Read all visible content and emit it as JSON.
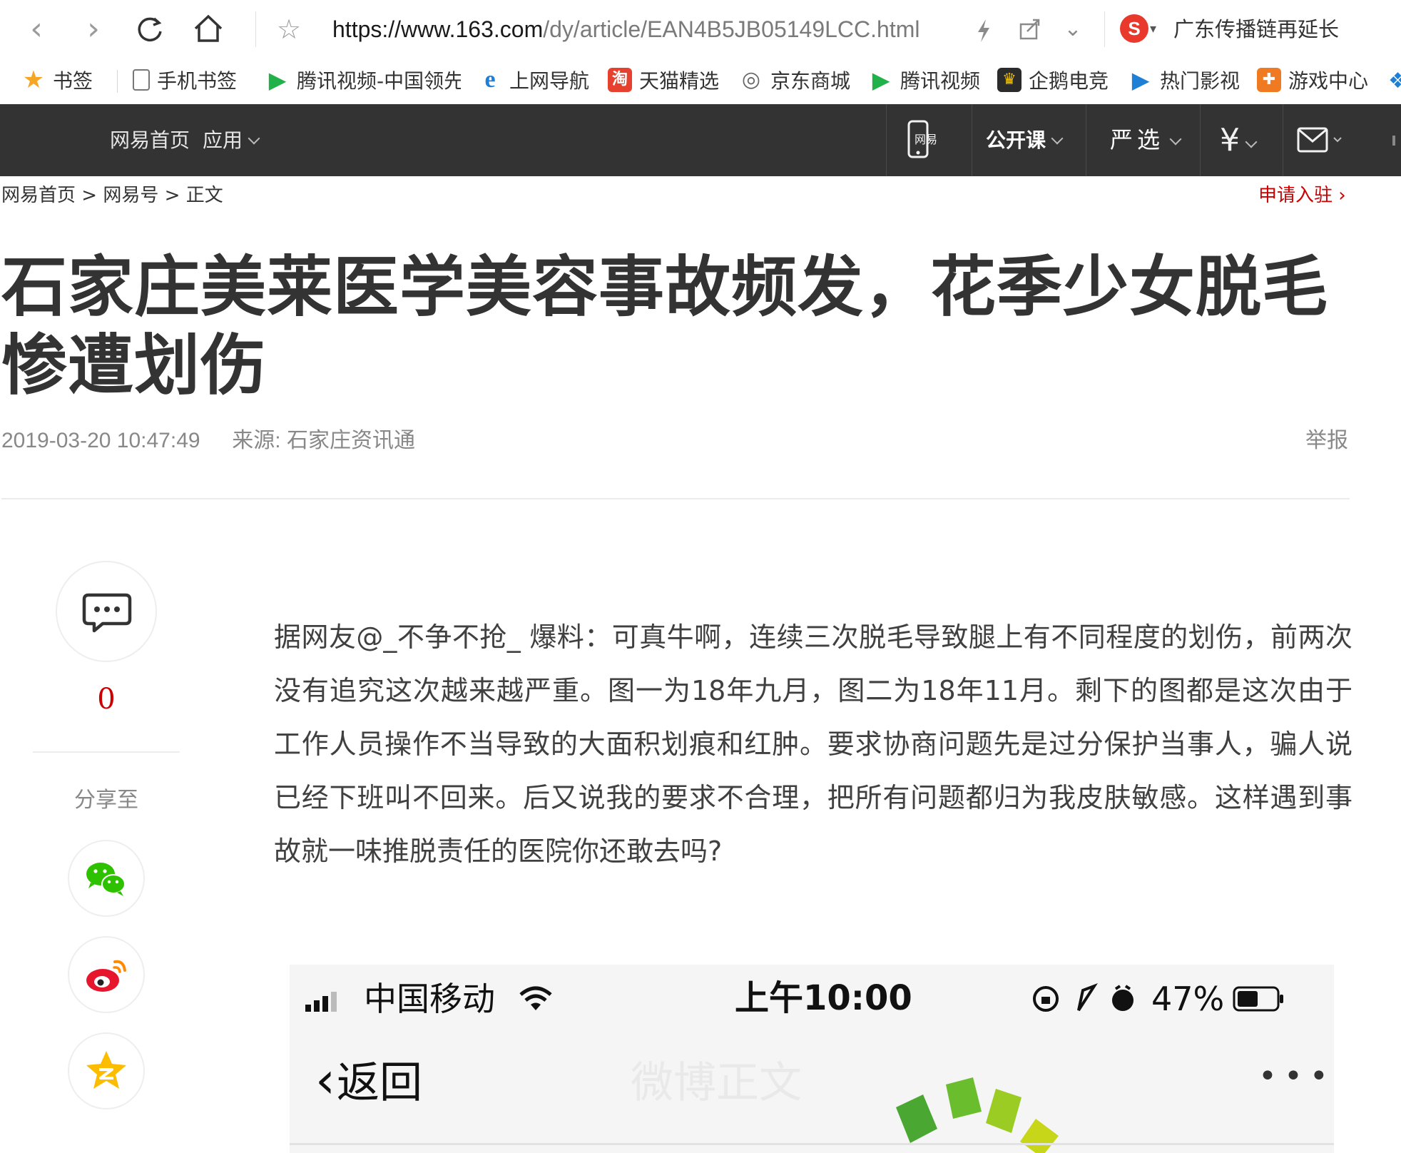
{
  "browser": {
    "url_host": "https://www.163.com",
    "url_path": "/dy/article/EAN4B5JB05149LCC.html",
    "search_hint": "广东传播链再延长",
    "search_engine_letter": "S"
  },
  "bookmarks": [
    {
      "label": "书签",
      "icon": "star-icon",
      "color": "#f5a623"
    },
    {
      "label": "手机书签",
      "icon": "phone-icon",
      "color": "#888888"
    },
    {
      "label": "腾讯视频-中国领先",
      "icon": "tencent-video-icon",
      "color": "#20b14a"
    },
    {
      "label": "上网导航",
      "icon": "ie-icon",
      "color": "#1e7fd6"
    },
    {
      "label": "天猫精选",
      "icon": "tmall-icon",
      "color": "#e6412e"
    },
    {
      "label": "京东商城",
      "icon": "globe-icon",
      "color": "#666666"
    },
    {
      "label": "腾讯视频",
      "icon": "tencent-video-icon",
      "color": "#20b14a"
    },
    {
      "label": "企鹅电竞",
      "icon": "penguin-esports-icon",
      "color": "#2b2b2b"
    },
    {
      "label": "热门影视",
      "icon": "play-icon",
      "color": "#1e7fd6"
    },
    {
      "label": "游戏中心",
      "icon": "gamepad-icon",
      "color": "#f07a22"
    }
  ],
  "site_header": {
    "home": "网易首页",
    "apps": "应用",
    "open_course": "公开课",
    "yanxuan": "严选"
  },
  "breadcrumb": {
    "home": "网易首页",
    "section": "网易号",
    "current": "正文",
    "separator": ">"
  },
  "apply_link": "申请入驻",
  "article": {
    "title": "石家庄美莱医学美容事故频发，花季少女脱毛惨遭划伤",
    "datetime": "2019-03-20 10:47:49",
    "source_label": "来源:",
    "source": "石家庄资讯通",
    "report": "举报",
    "body": "据网友@_不争不抢_ 爆料：可真牛啊，连续三次脱毛导致腿上有不同程度的划伤，前两次没有追究这次越来越严重。图一为18年九月，图二为18年11月。剩下的图都是这次由于工作人员操作不当导致的大面积划痕和红肿。要求协商问题先是过分保护当事人，骗人说已经下班叫不回来。后又说我的要求不合理，把所有问题都归为我皮肤敏感。这样遇到事故就一味推脱责任的医院你还敢去吗?"
  },
  "sidebar": {
    "comment_count": "0",
    "share_label": "分享至",
    "share_targets": [
      "wechat-icon",
      "weibo-icon",
      "qzone-icon"
    ]
  },
  "embedded_image": {
    "carrier": "中国移动",
    "time": "上午10:00",
    "battery": "47%",
    "back": "返回",
    "watermark": "微博正文"
  }
}
